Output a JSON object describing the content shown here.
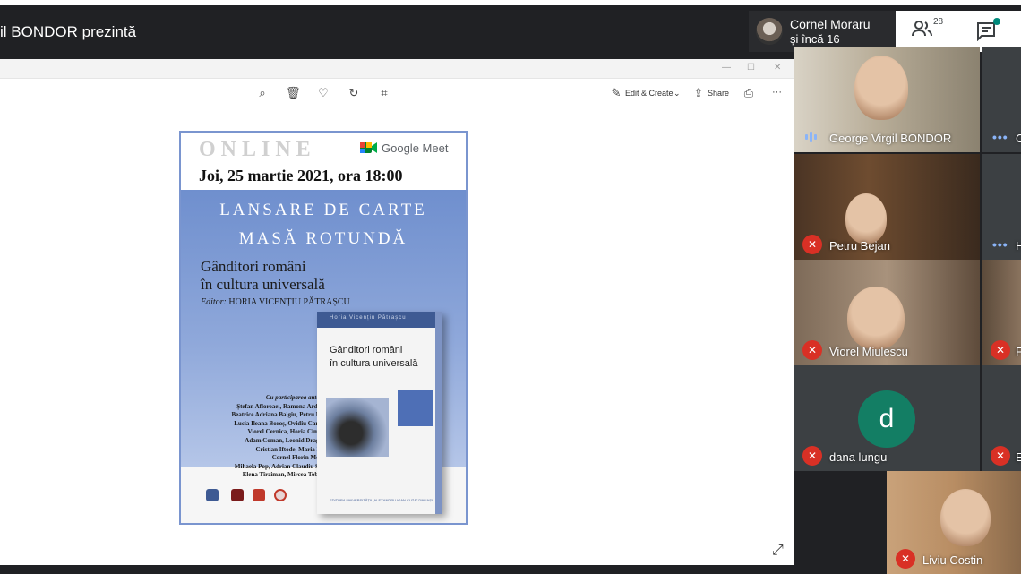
{
  "meet": {
    "presenting_label": "il BONDOR prezintă",
    "host_name": "Cornel Moraru",
    "host_more": "și încă 16",
    "people_count": "28",
    "icons": {
      "people": "people-icon",
      "chat": "chat-icon"
    }
  },
  "viewer": {
    "toolbar": {
      "zoom": "zoom-in-icon",
      "delete": "trash-icon",
      "favorite": "heart-icon",
      "rotate": "rotate-icon",
      "crop": "crop-icon",
      "edit_create": "Edit & Create",
      "share": "Share",
      "print": "print-icon",
      "more": "···"
    },
    "expand": "expand-icon"
  },
  "poster": {
    "online": "ONLINE",
    "gmeet": "Google Meet",
    "date": "Joi, 25 martie 2021, ora 18:00",
    "lansare": "LANSARE DE CARTE",
    "masa": "MASĂ ROTUNDĂ",
    "title_line1": "Gânditori români",
    "title_line2": "în cultura universală",
    "editor_label": "Editor:",
    "editor_name": "HORIA VICENȚIU PĂTRAȘCU",
    "participants_label": "Cu participarea autorilor:",
    "participants": [
      "Ștefan Afloroaei, Ramona Ardelean,",
      "Beatrice Adriana Balgiu, Petru Bejan,",
      "Lucia Ileana Boroș, Ovidiu Caraiani,",
      "Viorel Cernica, Horia Cimteală,",
      "Adam Coman, Leonid Dragomir,",
      "Cristian Iftode, Maria Micle,",
      "Cornel Florin Moraru,",
      "Mihaela Pop, Adrian Claudiu Stoica,",
      "Elena Tîrziman, Mircea Toboșaru"
    ],
    "book_author": "Horia Vicențiu Pătrașcu",
    "book_title_line1": "Gânditori români",
    "book_title_line2": "în cultura universală",
    "book_publisher": "EDITURA UNIVERSITĂȚII „ALEXANDRU IOAN CUZA\" DIN IAȘI"
  },
  "participants": [
    {
      "name": "George Virgil BONDOR",
      "state": "speaking"
    },
    {
      "name": "C",
      "state": "more"
    },
    {
      "name": "Petru Bejan",
      "state": "muted"
    },
    {
      "name": "H",
      "state": "more"
    },
    {
      "name": "Viorel Miulescu",
      "state": "muted"
    },
    {
      "name": "F",
      "state": "muted"
    },
    {
      "name": "dana lungu",
      "state": "muted",
      "avatar_letter": "d"
    },
    {
      "name": "E",
      "state": "muted"
    },
    {
      "name": "Liviu Costin",
      "state": "muted"
    }
  ],
  "colors": {
    "muted_red": "#d93025",
    "avatar_green": "#137e64",
    "meet_dark": "#202124"
  }
}
